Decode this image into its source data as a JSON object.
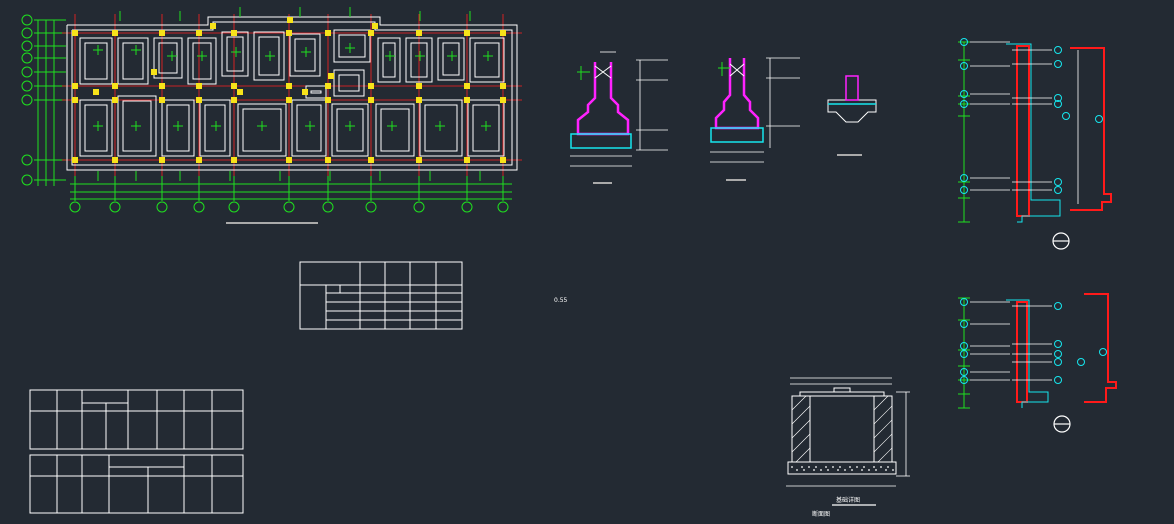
{
  "drawing": {
    "background_color": "#232a33",
    "colors": {
      "wall": "#ffffff",
      "axis": "#ff2020",
      "grid": "#1fe01f",
      "column": "#f7e31a",
      "rebar": "#ff22ff",
      "concrete": "#16e6ee",
      "section_red": "#ff1a1a",
      "callout": "#16e6ee"
    },
    "labels": {
      "elevation_mark": "0.55",
      "section_title_main": "基础详图",
      "section_title_sub": "断面图"
    },
    "icons": {
      "section_symbol_1": "section-circle-icon",
      "section_symbol_2": "section-circle-icon"
    }
  }
}
